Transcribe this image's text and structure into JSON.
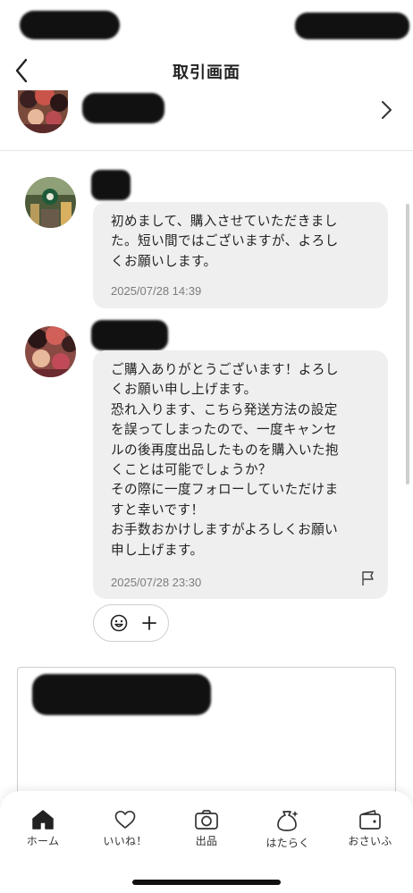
{
  "header": {
    "title": "取引画面",
    "back_icon": "chevron-left-icon"
  },
  "seller_row": {
    "chevron_icon": "chevron-right-icon"
  },
  "messages": [
    {
      "lines": [
        "初めまして、購入させていただきまし",
        "た。短い間ではございますが、よろし",
        "くお願いします。"
      ],
      "time": "2025/07/28 14:39"
    },
    {
      "lines": [
        "ご購入ありがとうございます！よろし",
        "くお願い申し上げます。",
        "恐れ入ります、こちら発送方法の設定",
        "を誤ってしまったので、一度キャンセ",
        "ルの後再度出品したものを購入いた抱",
        "くことは可能でしょうか？",
        "その際に一度フォローしていただけま",
        "すと幸いです！",
        "お手数おかけしますがよろしくお願い",
        "申し上げます。"
      ],
      "time": "2025/07/28 23:30",
      "report_icon": "flag-icon"
    }
  ],
  "reaction": {
    "emoji_icon": "emoji-icon",
    "add_icon": "plus-icon"
  },
  "bottom_nav": {
    "items": [
      {
        "label": "ホーム",
        "icon": "home-icon"
      },
      {
        "label": "いいね！",
        "icon": "heart-icon"
      },
      {
        "label": "出品",
        "icon": "camera-icon"
      },
      {
        "label": "はたらく",
        "icon": "money-bag-icon"
      },
      {
        "label": "おさいふ",
        "icon": "wallet-icon"
      }
    ]
  },
  "colors": {
    "bubble": "#efefef",
    "timestamp": "#7c7c7c",
    "text": "#222222",
    "border": "#cfcfcf"
  }
}
